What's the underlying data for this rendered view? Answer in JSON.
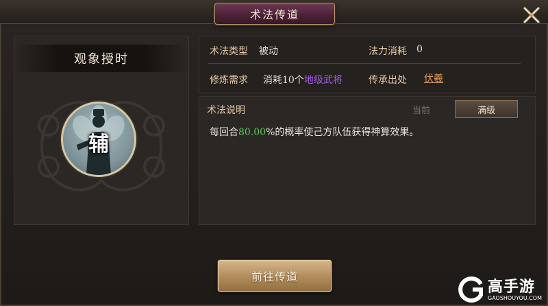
{
  "window": {
    "title": "术法传道"
  },
  "skill": {
    "name": "观象授时",
    "avatar_char": "辅"
  },
  "info": {
    "type_label": "术法类型",
    "type_value": "被动",
    "cost_label": "法力消耗",
    "cost_value": "0",
    "req_label": "修炼需求",
    "req_prefix": "消耗10个",
    "req_highlight": "地级武将",
    "source_label": "传承出处",
    "source_value": "伏羲"
  },
  "description": {
    "heading": "术法说明",
    "tab_current": "当前",
    "tab_max": "满级",
    "text_prefix": "每回合",
    "text_value": "80.00",
    "text_suffix": "%的概率使己方队伍获得神算效果。"
  },
  "actions": {
    "go_label": "前往传道"
  },
  "watermark": {
    "brand": "高手游",
    "domain": "GAOSHOUYOU.COM"
  },
  "colors": {
    "accent_purple": "#a55cf0",
    "accent_green": "#5cc95f",
    "button_gold": "#b48e5f",
    "title_plate": "#4e2238"
  }
}
